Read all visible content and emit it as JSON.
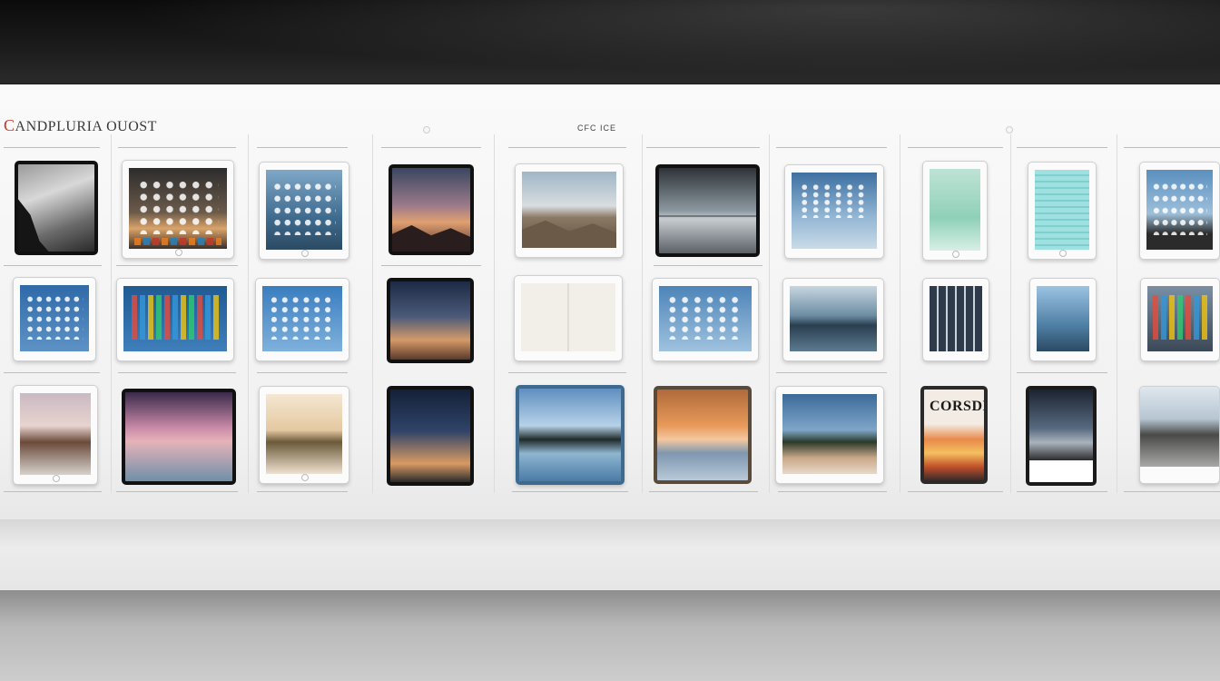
{
  "title": {
    "accent": "C",
    "rest": "ANDPLURIA OUOST"
  },
  "code": "CFC ICE",
  "colors": {
    "accent_red": "#c0392b",
    "panel": "#f5f5f5",
    "dark_band": "#111111"
  },
  "devices": [
    {
      "name": "tablet-1",
      "style": "dark",
      "screen": "storm-cliff"
    },
    {
      "name": "tablet-2",
      "style": "white",
      "screen": "homescreen-sunset"
    },
    {
      "name": "tablet-3",
      "style": "white",
      "screen": "homescreen-blue"
    },
    {
      "name": "tablet-4",
      "style": "dark",
      "screen": "sunset-hills"
    },
    {
      "name": "tablet-5",
      "style": "white",
      "screen": "road-landscape"
    },
    {
      "name": "tablet-6",
      "style": "dark",
      "screen": "grey-sea"
    },
    {
      "name": "tablet-7",
      "style": "white",
      "screen": "ui-lake"
    },
    {
      "name": "tablet-8",
      "style": "white",
      "screen": "mint-gradient"
    },
    {
      "name": "tablet-9",
      "style": "white",
      "screen": "teal-list"
    },
    {
      "name": "tablet-10",
      "style": "white",
      "screen": "homescreen-coast"
    },
    {
      "name": "tablet-11",
      "style": "white",
      "screen": "homescreen-blue"
    },
    {
      "name": "tablet-12",
      "style": "white",
      "screen": "homescreen-wide"
    },
    {
      "name": "tablet-13",
      "style": "white",
      "screen": "homescreen-blue"
    },
    {
      "name": "tablet-14",
      "style": "dark",
      "screen": "dusk"
    },
    {
      "name": "tablet-15",
      "style": "white",
      "screen": "sketch-book"
    },
    {
      "name": "tablet-16",
      "style": "white",
      "screen": "city-grid"
    },
    {
      "name": "tablet-17",
      "style": "white",
      "screen": "calm-lake"
    },
    {
      "name": "tablet-18",
      "style": "white",
      "screen": "app-grid"
    },
    {
      "name": "tablet-19",
      "style": "white",
      "screen": "blue-coast"
    },
    {
      "name": "tablet-20",
      "style": "white",
      "screen": "app-grid-red"
    },
    {
      "name": "tablet-21",
      "style": "white",
      "screen": "pink-dusk"
    },
    {
      "name": "tablet-22",
      "style": "dark",
      "screen": "pink-lake-tree"
    },
    {
      "name": "tablet-23",
      "style": "white",
      "screen": "beige-shore"
    },
    {
      "name": "tablet-24",
      "style": "dark",
      "screen": "dusk-streak"
    },
    {
      "name": "tablet-25",
      "style": "white",
      "screen": "blue-reflection"
    },
    {
      "name": "tablet-26",
      "style": "dark",
      "screen": "orange-sea"
    },
    {
      "name": "tablet-27",
      "style": "white",
      "screen": "forest-shore"
    },
    {
      "name": "tablet-28",
      "style": "dark",
      "screen": "bold-sunset"
    },
    {
      "name": "tablet-29",
      "style": "dark",
      "screen": "dark-coast"
    },
    {
      "name": "tablet-30",
      "style": "white",
      "screen": "grey-beach"
    }
  ],
  "poster_text": "CORSDEL"
}
